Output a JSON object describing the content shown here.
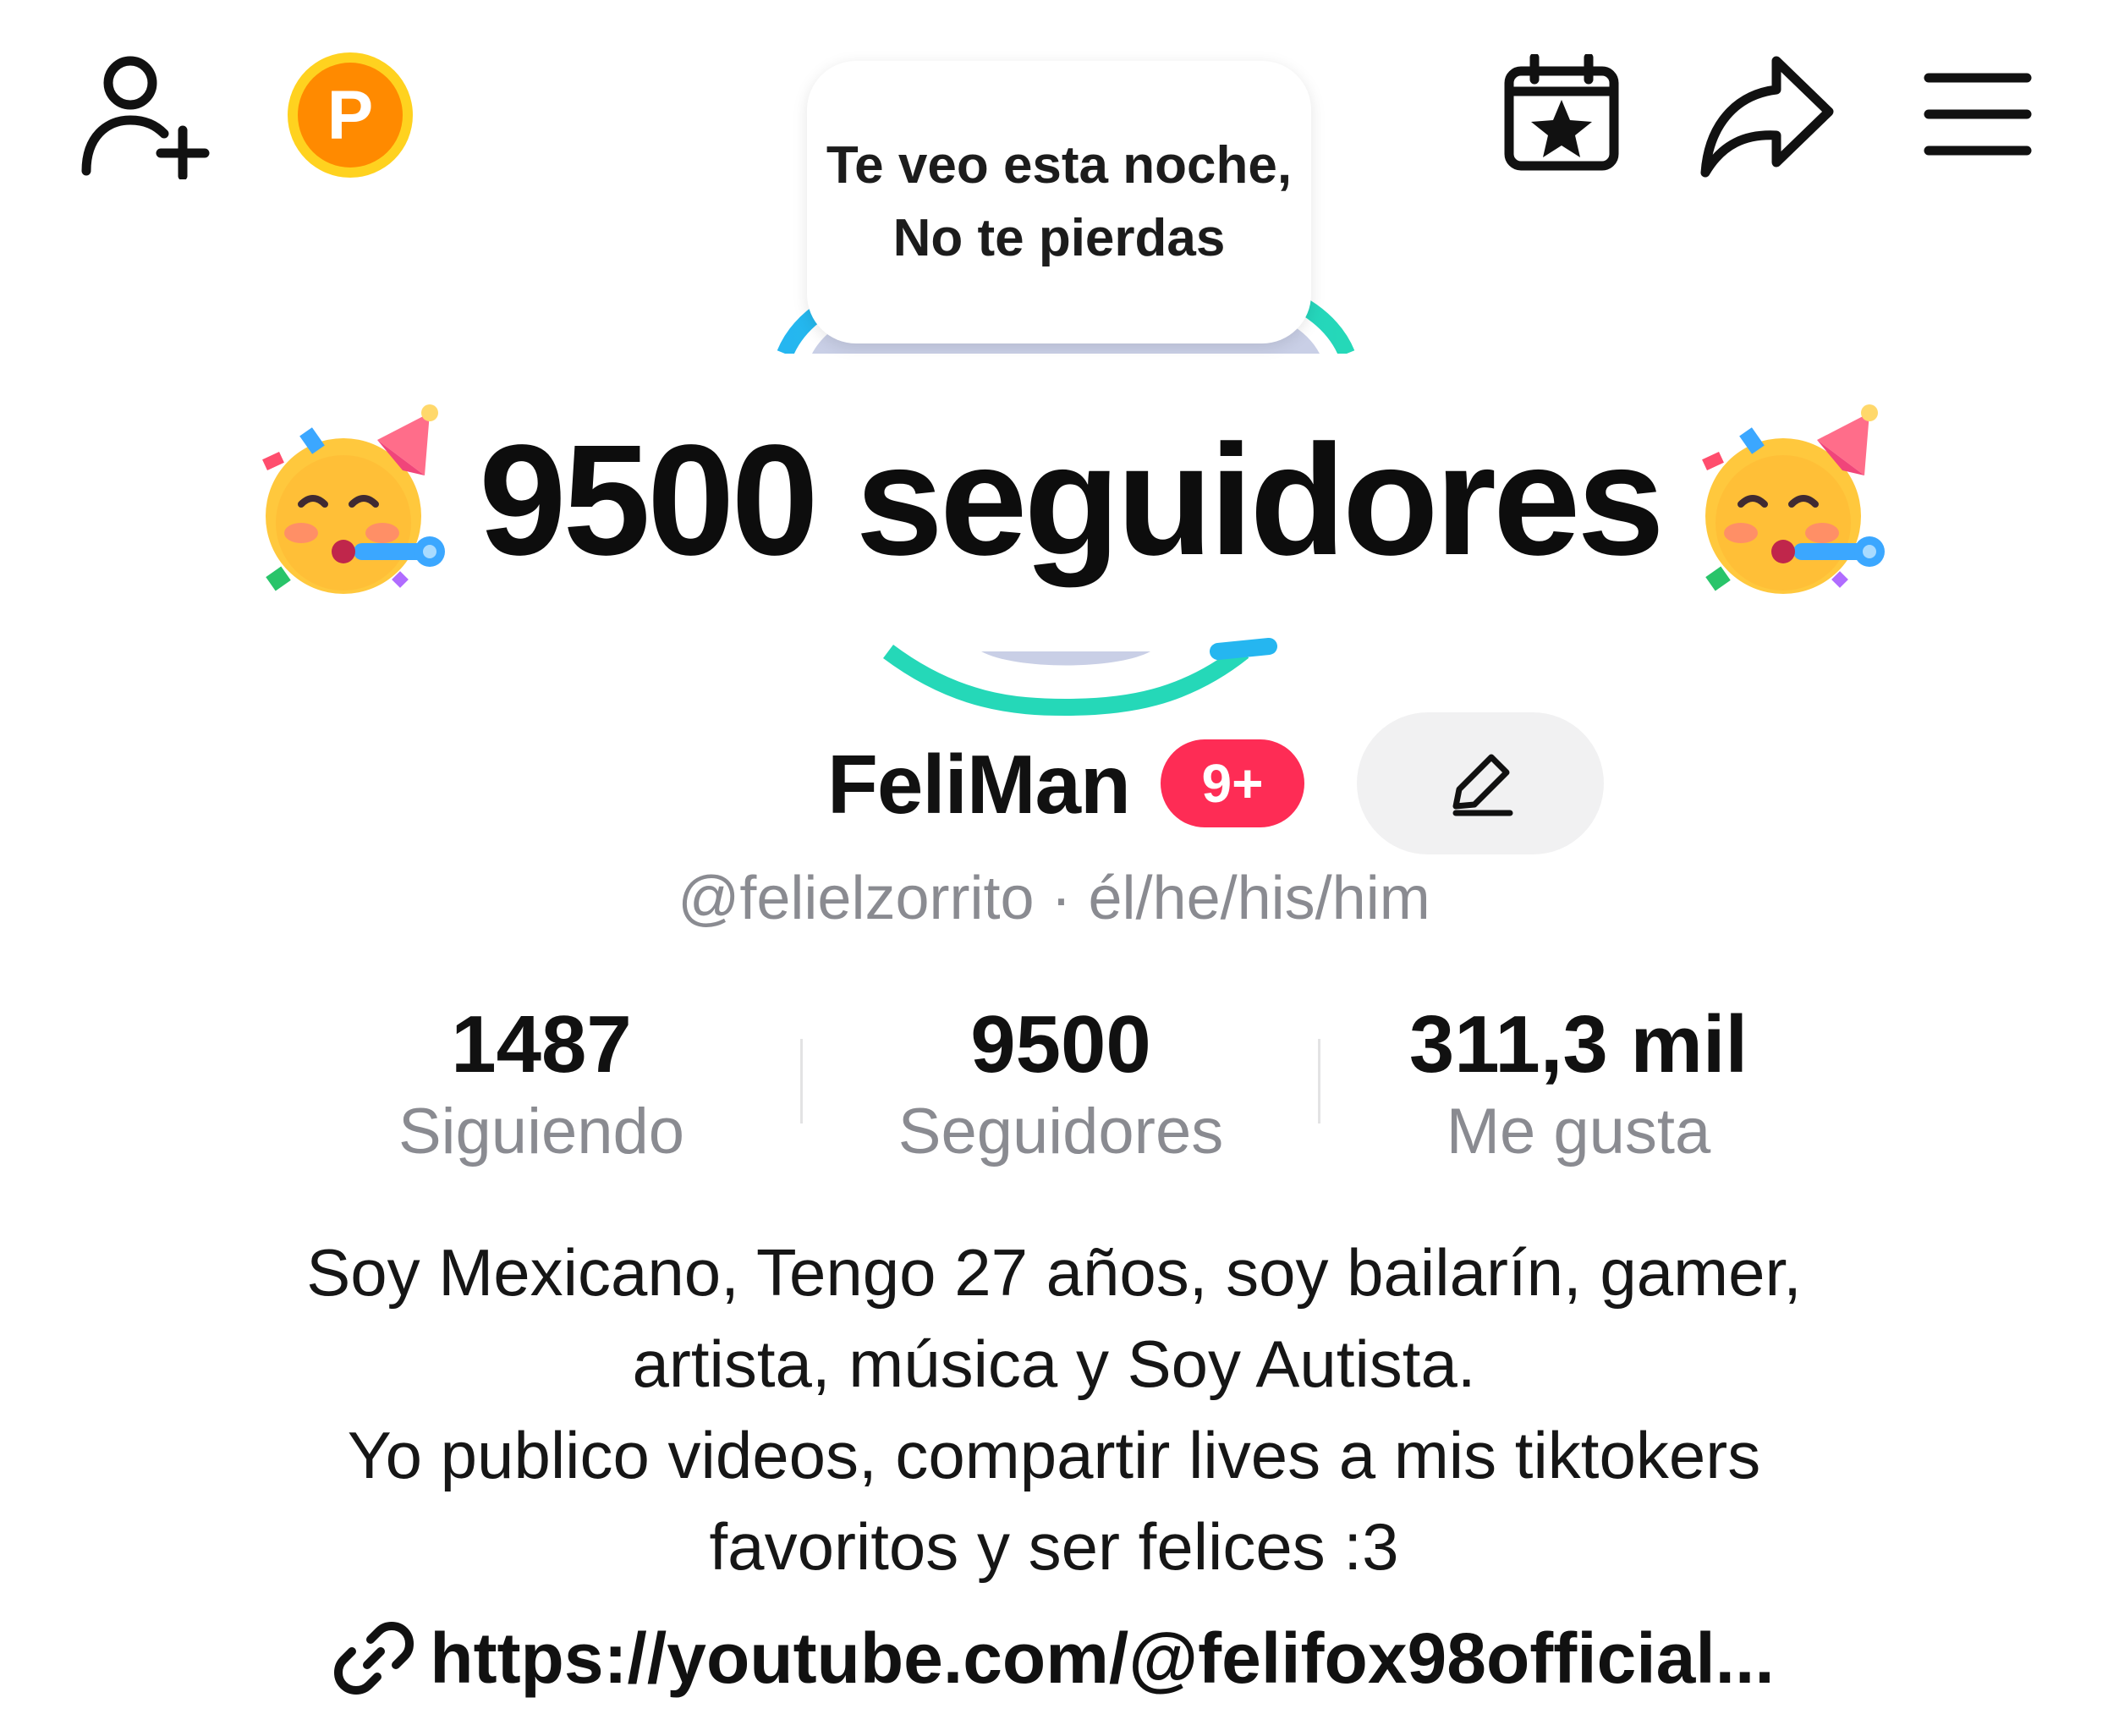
{
  "header": {
    "add_friend_icon": "person-plus-icon",
    "points_badge_label": "P",
    "calendar_icon": "calendar-star-icon",
    "share_icon": "share-arrow-icon",
    "menu_icon": "hamburger-menu-icon"
  },
  "story_bubble": {
    "text": "Te veo esta noche,      No te pierdas"
  },
  "sticker": {
    "text": "9500 seguidores",
    "emoji": "🥳"
  },
  "profile": {
    "display_name": "FeliMan",
    "notification_badge": "9+",
    "handle_line": "@felielzorrito · él/he/his/him"
  },
  "stats": [
    {
      "value": "1487",
      "label": "Siguiendo"
    },
    {
      "value": "9500",
      "label": "Seguidores"
    },
    {
      "value": "311,3 mil",
      "label": "Me gusta"
    }
  ],
  "bio": {
    "lines": [
      "Soy Mexicano, Tengo 27 años, soy bailarín, gamer,",
      "artista, música y Soy Autista.",
      "Yo publico videos, compartir lives a mis tiktokers",
      "favoritos y ser felices :3"
    ]
  },
  "link": {
    "text": "https://youtube.com/@felifox98official..."
  },
  "colors": {
    "accent_red": "#fe2c55",
    "points_orange": "#ff8a00",
    "ring_blue": "#25b6f0",
    "ring_teal": "#25d8b8",
    "muted_text": "#8a8b91"
  }
}
